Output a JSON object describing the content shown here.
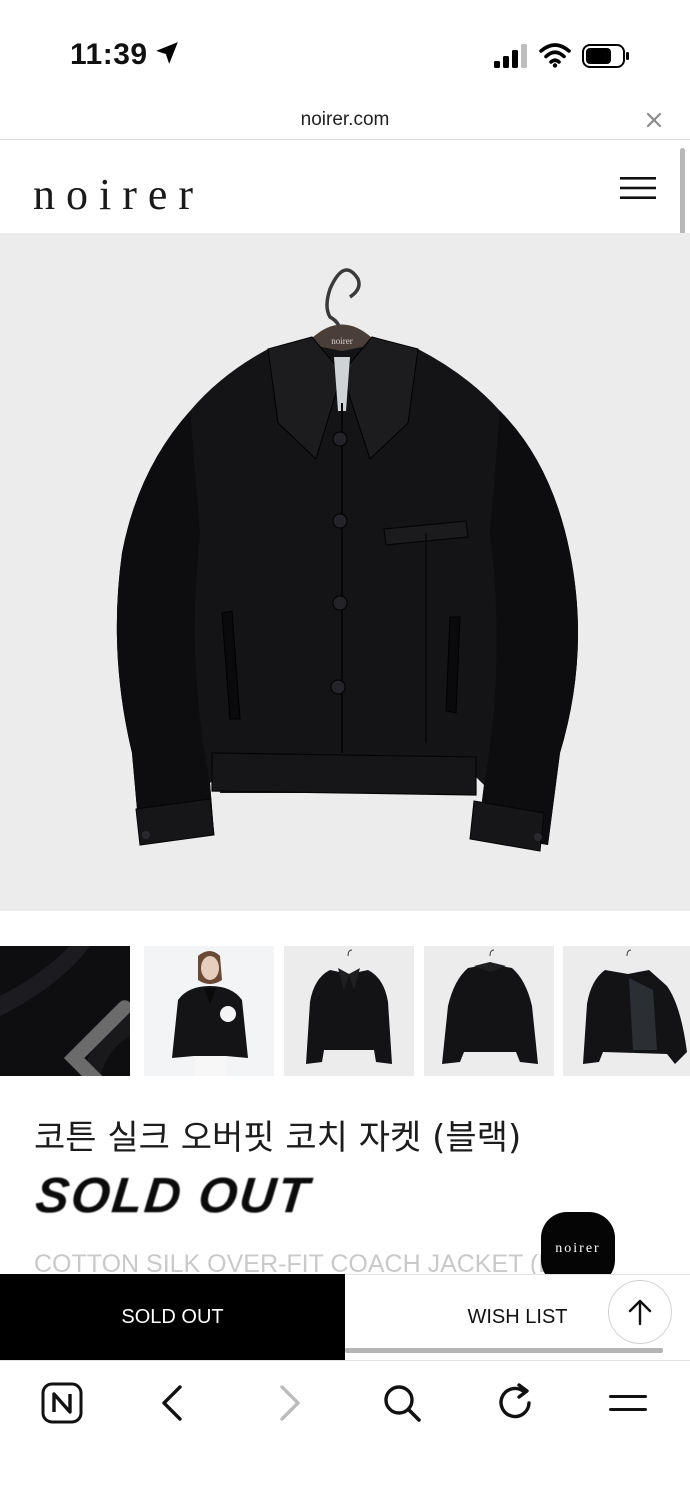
{
  "status_bar": {
    "time": "11:39",
    "icons": [
      "location-arrow-icon",
      "cellular-signal-icon",
      "wifi-icon",
      "battery-icon"
    ]
  },
  "browser": {
    "url": "noirer.com",
    "close_icon": "close-icon"
  },
  "site": {
    "logo": "noirer",
    "menu_icon": "hamburger-menu-icon"
  },
  "hero": {
    "hanger_brand": "noirer"
  },
  "thumbnails": {
    "count": 5,
    "prev_icon": "chevron-left-icon"
  },
  "product": {
    "name_ko": "코튼 실크 오버핏 코치 자켓 (블랙)",
    "status": "SOLD OUT",
    "name_en": "COTTON SILK OVER-FIT COACH JACKET (BLACK)"
  },
  "chat": {
    "label": "noirer"
  },
  "actions": {
    "sold_out_label": "SOLD OUT",
    "wish_list_label": "WISH LIST",
    "top_icon": "arrow-up-icon"
  },
  "toolbar": {
    "icons": [
      "naver-n-icon",
      "back-icon",
      "forward-icon",
      "search-icon",
      "reload-icon",
      "menu-icon"
    ]
  },
  "colors": {
    "primary": "#000000",
    "background": "#ffffff",
    "hero_background": "#ececec"
  }
}
